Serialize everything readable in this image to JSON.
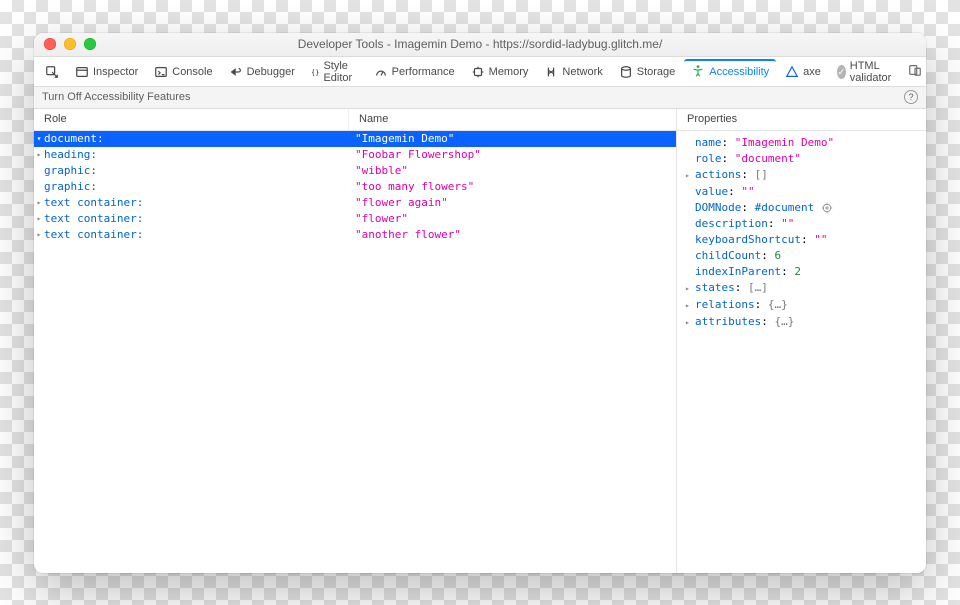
{
  "window_title": "Developer Tools - Imagemin Demo - https://sordid-ladybug.glitch.me/",
  "tabs": {
    "inspector": "Inspector",
    "console": "Console",
    "debugger": "Debugger",
    "style_editor": "Style Editor",
    "performance": "Performance",
    "memory": "Memory",
    "network": "Network",
    "storage": "Storage",
    "accessibility": "Accessibility",
    "axe": "axe",
    "html_validator": "HTML validator"
  },
  "subbar": {
    "toggle": "Turn Off Accessibility Features"
  },
  "headers": {
    "role": "Role",
    "name": "Name",
    "properties": "Properties"
  },
  "tree": [
    {
      "role": "document:",
      "name": "\"Imagemin Demo\"",
      "indent": 0,
      "twisty": "down",
      "selected": true
    },
    {
      "role": "heading:",
      "name": "\"Foobar Flowershop\"",
      "indent": 1,
      "twisty": "right",
      "selected": false
    },
    {
      "role": "graphic:",
      "name": "\"wibble\"",
      "indent": 1,
      "twisty": "",
      "selected": false
    },
    {
      "role": "graphic:",
      "name": "\"too many flowers\"",
      "indent": 1,
      "twisty": "",
      "selected": false
    },
    {
      "role": "text container:",
      "name": "\"flower again\"",
      "indent": 1,
      "twisty": "right",
      "selected": false
    },
    {
      "role": "text container:",
      "name": "\"flower\"",
      "indent": 1,
      "twisty": "right",
      "selected": false
    },
    {
      "role": "text container:",
      "name": "\"another flower\"",
      "indent": 1,
      "twisty": "right",
      "selected": false
    }
  ],
  "properties": {
    "name_k": "name",
    "name_v": "\"Imagemin Demo\"",
    "role_k": "role",
    "role_v": "\"document\"",
    "actions_k": "actions",
    "actions_v": "[]",
    "value_k": "value",
    "value_v": "\"\"",
    "dom_k": "DOMNode",
    "dom_v": "#document",
    "desc_k": "description",
    "desc_v": "\"\"",
    "kbd_k": "keyboardShortcut",
    "kbd_v": "\"\"",
    "childcount_k": "childCount",
    "childcount_v": "6",
    "idx_k": "indexInParent",
    "idx_v": "2",
    "states_k": "states",
    "states_v": "[…]",
    "relations_k": "relations",
    "relations_v": "{…}",
    "attrs_k": "attributes",
    "attrs_v": "{…}"
  }
}
